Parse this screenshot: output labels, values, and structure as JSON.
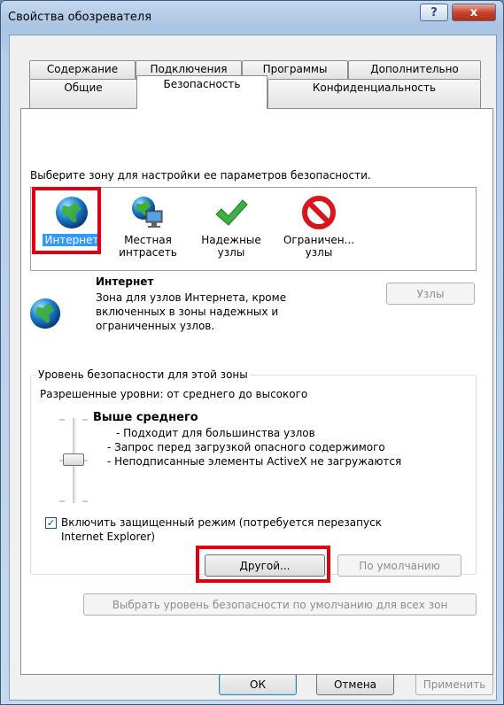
{
  "window": {
    "title": "Свойства обозревателя"
  },
  "title_buttons": {
    "help": "?",
    "close": "x"
  },
  "tabs": {
    "row1": [
      "Содержание",
      "Подключения",
      "Программы",
      "Дополнительно"
    ],
    "row2": [
      "Общие",
      "Безопасность",
      "Конфиденциальность"
    ],
    "active": "Безопасность"
  },
  "security": {
    "prompt": "Выберите зону для настройки ее параметров безопасности.",
    "zones": [
      {
        "label1": "Интернет",
        "label2": "",
        "icon": "globe-icon",
        "selected": true
      },
      {
        "label1": "Местная",
        "label2": "интрасеть",
        "icon": "intranet-icon",
        "selected": false
      },
      {
        "label1": "Надежные",
        "label2": "узлы",
        "icon": "checkmark-icon",
        "selected": false
      },
      {
        "label1": "Ограничен...",
        "label2": "узлы",
        "icon": "restricted-icon",
        "selected": false
      }
    ],
    "zone_info": {
      "title": "Интернет",
      "desc1": "Зона для узлов Интернета, кроме",
      "desc2": "включенных в зоны надежных и",
      "desc3": "ограниченных узлов."
    },
    "sites_button": "Узлы",
    "level": {
      "group_label": "Уровень безопасности для этой зоны",
      "allowed": "Разрешенные уровни: от среднего до высокого",
      "name": "Выше среднего",
      "bullets": [
        "- Подходит для большинства узлов",
        "- Запрос перед загрузкой опасного содержимого",
        "- Неподписанные элементы ActiveX не загружаются"
      ]
    },
    "protected_mode": {
      "checked": true,
      "line1": "Включить защищенный режим (потребуется перезапуск",
      "line2": "Internet Explorer)"
    },
    "custom_button": "Другой...",
    "default_button": "По умолчанию",
    "reset_all_button": "Выбрать уровень безопасности по умолчанию для всех зон"
  },
  "footer": {
    "ok": "ОК",
    "cancel": "Отмена",
    "apply": "Применить"
  },
  "colors": {
    "highlight": "#e00012",
    "selection": "#3399ff"
  }
}
